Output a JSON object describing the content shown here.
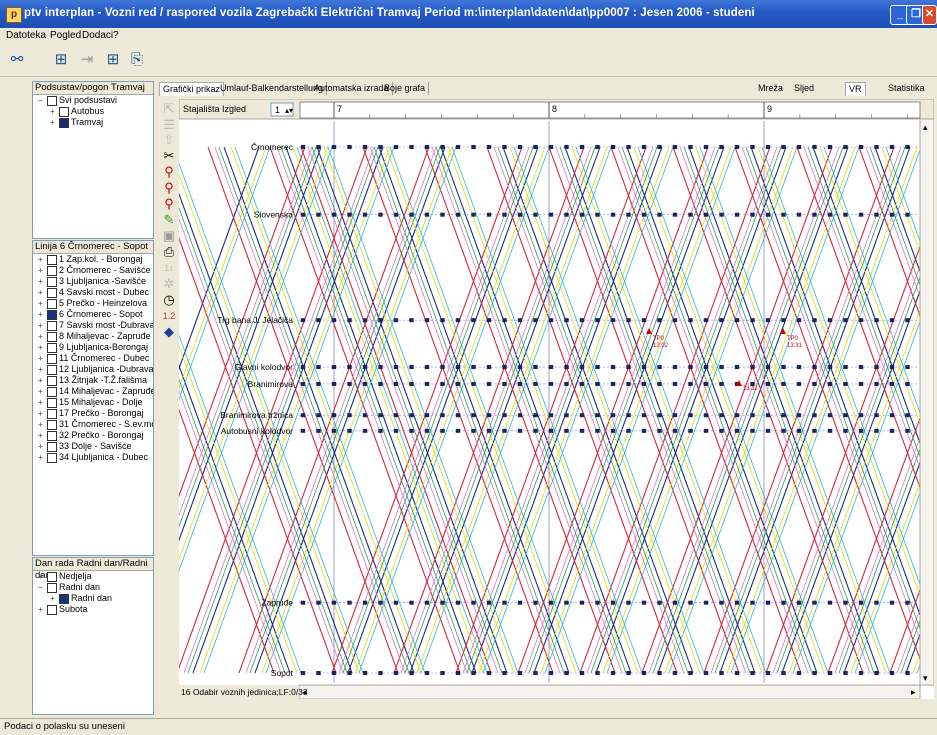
{
  "window": {
    "title": "ptv interplan - Vozni red / raspored vozila  Zagrebački Električni Tramvaj Period m:\\interplan\\daten\\dat\\pp0007 : Jesen 2006 - studeni",
    "app_icon": "ptv-app-icon"
  },
  "menu": [
    "Datoteka",
    "Pogled",
    "Dodaci",
    "?"
  ],
  "toolbar_icons": [
    "binoculars-icon",
    "grid-icon",
    "arrow-icon",
    "layout-icon",
    "export-icon"
  ],
  "subsystem_panel": {
    "title": "Podsustav/pogon  Tramvaj",
    "items": [
      {
        "label": "Svi podsustavi",
        "level": 0,
        "expander": "−",
        "checked": false
      },
      {
        "label": "Autobus",
        "level": 1,
        "expander": "+",
        "checked": false
      },
      {
        "label": "Tramvaj",
        "level": 1,
        "expander": "+",
        "checked": true
      }
    ]
  },
  "lines_panel": {
    "title": "Linija 6 Črnomerec - Sopot",
    "items": [
      {
        "label": "1 Zap.kol. - Borongaj",
        "checked": false
      },
      {
        "label": "2 Črnomerec - Savišće",
        "checked": false
      },
      {
        "label": "3 Ljubljanica -Savišće",
        "checked": false
      },
      {
        "label": "4 Savski most - Dubec",
        "checked": false
      },
      {
        "label": "5 Prečko - Heinzelova",
        "checked": false
      },
      {
        "label": "6 Črnomerec - Sopot",
        "checked": true
      },
      {
        "label": "7 Savski most -Dubrava",
        "checked": false
      },
      {
        "label": "8 Mihaljevac - Zapruđe",
        "checked": false
      },
      {
        "label": "9 Ljubljanica-Borongaj",
        "checked": false
      },
      {
        "label": "11 Črnomerec - Dubec",
        "checked": false
      },
      {
        "label": "12 Ljubljanica -Dubrava",
        "checked": false
      },
      {
        "label": "13 Žitnjak -T.Ž.fališma",
        "checked": false
      },
      {
        "label": "14 Mihaljevac - Zapruđe",
        "checked": false
      },
      {
        "label": "15 Mihaljevac - Dolje",
        "checked": false
      },
      {
        "label": "17 Prečko - Borongaj",
        "checked": false
      },
      {
        "label": "31 Črnomerec - S.ev.most",
        "checked": false
      },
      {
        "label": "32 Prečko - Borongaj",
        "checked": false
      },
      {
        "label": "33 Dolje - Savišće",
        "checked": false
      },
      {
        "label": "34 Ljubljanica - Dubec",
        "checked": false
      }
    ]
  },
  "daytype_panel": {
    "title": "Dan rada  Radni dan/Radni dan",
    "items": [
      {
        "label": "Nedjelja",
        "level": 0,
        "expander": "+",
        "checked": false
      },
      {
        "label": "Radni dan",
        "level": 0,
        "expander": "−",
        "checked": false
      },
      {
        "label": "Radni dan",
        "level": 1,
        "expander": "+",
        "checked": true
      },
      {
        "label": "Subota",
        "level": 0,
        "expander": "+",
        "checked": false
      }
    ]
  },
  "tabs": [
    "Grafički prikaz",
    "Umlauf-Balkendarstellung",
    "Automatska izrada",
    "Boje grafa"
  ],
  "right_tabs": [
    "Mreža",
    "Sljed",
    "VR",
    "Statistika"
  ],
  "graph": {
    "header_label": "Stajališta  Izgled",
    "spinner_value": "1",
    "hours": [
      "7",
      "8",
      "9"
    ],
    "stops": [
      {
        "name": "Črnomerec",
        "dist": 0
      },
      {
        "name": "Slovenska",
        "dist": 2.6
      },
      {
        "name": "Trg bana J. Jelačića",
        "dist": 6.65
      },
      {
        "name": "Glavni kolodvor",
        "dist": 8.45
      },
      {
        "name": "Branimirova",
        "dist": 9.1
      },
      {
        "name": "Branimirova tržnica",
        "dist": 10.3
      },
      {
        "name": "Autobusni kolodvor",
        "dist": 10.9
      },
      {
        "name": "Zapruđe",
        "dist": 17.5
      },
      {
        "name": "Sopot",
        "dist": 20.2
      }
    ],
    "annotations": [
      {
        "code": "TP0",
        "time": "13:02"
      },
      {
        "code": "TP0",
        "time": "13:31"
      },
      {
        "code": "",
        "time": "13:11"
      }
    ],
    "status_text": "16 Odabir voznih jedinica;LF:0/33",
    "colors": {
      "up": "#1c2a7c",
      "down": "#d3273a",
      "yellow": "#e8d800",
      "pink": "#e070d0",
      "cyan": "#29b8d8",
      "green": "#26a046",
      "dot": "#1a2460",
      "grid": "#8888c0"
    }
  },
  "status_bar": "Podaci o polasku su uneseni"
}
